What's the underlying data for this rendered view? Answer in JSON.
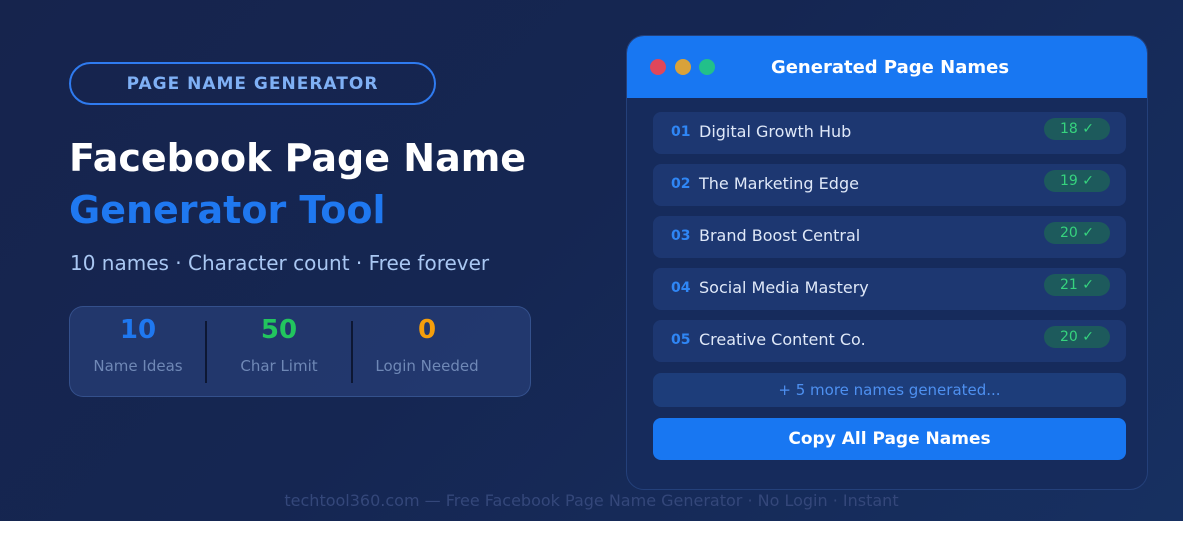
{
  "hero": {
    "pill_label": "PAGE NAME GENERATOR",
    "title_line1": "Facebook Page Name",
    "title_line2": "Generator Tool",
    "subtitle": "10 names · Character count · Free forever"
  },
  "stats": [
    {
      "value": "10",
      "label": "Name Ideas",
      "color": "#1f78f0"
    },
    {
      "value": "50",
      "label": "Char Limit",
      "color": "#22c55e"
    },
    {
      "value": "0",
      "label": "Login Needed",
      "color": "#f59e0b"
    }
  ],
  "card": {
    "title": "Generated Page Names",
    "window_dots": [
      "#e0475a",
      "#d9a23a",
      "#22c08a"
    ],
    "names": [
      {
        "num": "01",
        "name": "Digital Growth Hub",
        "count": "18 ✓"
      },
      {
        "num": "02",
        "name": "The Marketing Edge",
        "count": "19 ✓"
      },
      {
        "num": "03",
        "name": "Brand Boost Central",
        "count": "20 ✓"
      },
      {
        "num": "04",
        "name": "Social Media Mastery",
        "count": "21 ✓"
      },
      {
        "num": "05",
        "name": "Creative Content Co.",
        "count": "20 ✓"
      }
    ],
    "more_text": "+ 5 more names generated...",
    "copy_label": "Copy All Page Names"
  },
  "footer": "techtool360.com — Free Facebook Page Name Generator · No Login · Instant",
  "colors": {
    "accent": "#1877f2",
    "success": "#36d37e"
  }
}
